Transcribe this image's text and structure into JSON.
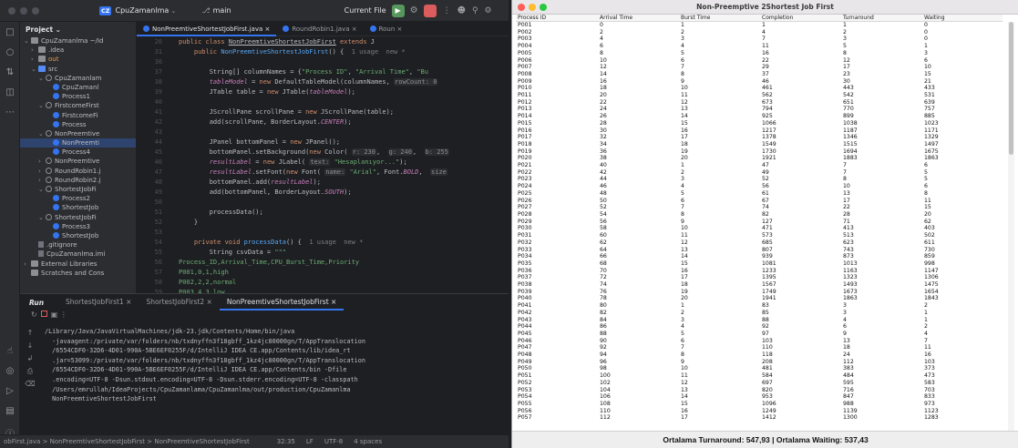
{
  "ide": {
    "project_badge": "CZ",
    "project_name": "CpuZamanlma",
    "branch": "main",
    "current_file": "Current File",
    "project_panel_title": "Project",
    "tree": [
      {
        "label": "CpuZamanlma ~/Id",
        "indent": 0,
        "icon": "folder",
        "arrow": "v"
      },
      {
        "label": ".idea",
        "indent": 1,
        "icon": "folder",
        "arrow": ">"
      },
      {
        "label": "out",
        "indent": 1,
        "icon": "folder",
        "arrow": ">",
        "style": "orange"
      },
      {
        "label": "src",
        "indent": 1,
        "icon": "folder-blue",
        "arrow": "v"
      },
      {
        "label": "CpuZamanlam",
        "indent": 2,
        "icon": "pkg",
        "arrow": "v"
      },
      {
        "label": "CpuZamanl",
        "indent": 3,
        "icon": "class",
        "arrow": ""
      },
      {
        "label": "Process1",
        "indent": 3,
        "icon": "class",
        "arrow": ""
      },
      {
        "label": "FirstcomeFirst",
        "indent": 2,
        "icon": "pkg",
        "arrow": "v"
      },
      {
        "label": "FirstcomeFi",
        "indent": 3,
        "icon": "class",
        "arrow": ""
      },
      {
        "label": "Process",
        "indent": 3,
        "icon": "class",
        "arrow": ""
      },
      {
        "label": "NonPreemtive",
        "indent": 2,
        "icon": "pkg",
        "arrow": "v"
      },
      {
        "label": "NonPreemti",
        "indent": 3,
        "icon": "class",
        "arrow": "",
        "style": "sel"
      },
      {
        "label": "Process4",
        "indent": 3,
        "icon": "class",
        "arrow": ""
      },
      {
        "label": "NonPreemtive",
        "indent": 2,
        "icon": "pkg",
        "arrow": ">"
      },
      {
        "label": "RoundRobin1.j",
        "indent": 2,
        "icon": "pkg",
        "arrow": ">"
      },
      {
        "label": "RoundRobin2.j",
        "indent": 2,
        "icon": "pkg",
        "arrow": ">"
      },
      {
        "label": "ShortestJobFi",
        "indent": 2,
        "icon": "pkg",
        "arrow": "v"
      },
      {
        "label": "Process2",
        "indent": 3,
        "icon": "class",
        "arrow": ""
      },
      {
        "label": "ShortestJob",
        "indent": 3,
        "icon": "class",
        "arrow": ""
      },
      {
        "label": "ShortestJobFi",
        "indent": 2,
        "icon": "pkg",
        "arrow": "v"
      },
      {
        "label": "Process3",
        "indent": 3,
        "icon": "class",
        "arrow": ""
      },
      {
        "label": "ShortestJob",
        "indent": 3,
        "icon": "class",
        "arrow": ""
      },
      {
        "label": ".gitignore",
        "indent": 1,
        "icon": "file",
        "arrow": ""
      },
      {
        "label": "CpuZamanlma.imi",
        "indent": 1,
        "icon": "file",
        "arrow": ""
      },
      {
        "label": "External Libraries",
        "indent": 0,
        "icon": "folder",
        "arrow": ">"
      },
      {
        "label": "Scratches and Cons",
        "indent": 0,
        "icon": "folder",
        "arrow": ""
      }
    ],
    "editor_tabs": [
      {
        "label": "NonPreemtiveShortestJobFirst.java",
        "active": true
      },
      {
        "label": "RoundRobin1.java",
        "active": false
      },
      {
        "label": "Roun",
        "active": false
      }
    ],
    "run_title": "Run",
    "run_tabs": [
      {
        "label": "ShortestJobFirst1",
        "active": false
      },
      {
        "label": "ShortestJobFirst2",
        "active": false
      },
      {
        "label": "NonPreemtiveShortestJobFirst",
        "active": true
      }
    ],
    "console_text": "/Library/Java/JavaVirtualMachines/jdk-23.jdk/Contents/Home/bin/java\n  -javaagent:/private/var/folders/nb/txdnyffn3f18gbff_1kz4jc80000gn/T/AppTranslocation\n  /6554CDF0-32D6-4D01-990A-5BE6EF0255F/d/IntelliJ IDEA CE.app/Contents/lib/idea_rt\n  .jar=53099:/private/var/folders/nb/txdnyffn3f18gbff_1kz4jc80000gn/T/AppTranslocation\n  /6554CDF0-32D6-4D01-990A-5BE6EF0255F/d/IntelliJ IDEA CE.app/Contents/bin -Dfile\n  .encoding=UTF-8 -Dsun.stdout.encoding=UTF-8 -Dsun.stderr.encoding=UTF-8 -classpath\n  /Users/emrullah/IdeaProjects/CpuZamanlama/CpuZamanlma/out/production/CpuZamanlma\n  NonPreemtiveShortestJobFirst",
    "status": {
      "breadcrumb": "obFirst.java > NonPreemtiveShortestJobFirst > NonPreemtiveShortestJobFirst",
      "position": "32:35",
      "line_ending": "LF",
      "encoding": "UTF-8",
      "indent": "4 spaces"
    }
  },
  "app": {
    "title": "Non-Preemptive 2Shortest Job First",
    "columns": [
      "Process ID",
      "Arrival Time",
      "Burst Time",
      "Completion",
      "Turnaround",
      "Waiting"
    ],
    "rows": [
      [
        "P001",
        "0",
        "1",
        "1",
        "1",
        "0"
      ],
      [
        "P002",
        "2",
        "2",
        "4",
        "2",
        "0"
      ],
      [
        "P003",
        "4",
        "3",
        "7",
        "3",
        "0"
      ],
      [
        "P004",
        "6",
        "4",
        "11",
        "5",
        "1"
      ],
      [
        "P005",
        "8",
        "5",
        "16",
        "8",
        "3"
      ],
      [
        "P006",
        "10",
        "6",
        "22",
        "12",
        "6"
      ],
      [
        "P007",
        "12",
        "7",
        "29",
        "17",
        "10"
      ],
      [
        "P008",
        "14",
        "8",
        "37",
        "23",
        "15"
      ],
      [
        "P009",
        "16",
        "9",
        "46",
        "30",
        "21"
      ],
      [
        "P010",
        "18",
        "10",
        "461",
        "443",
        "433"
      ],
      [
        "P011",
        "20",
        "11",
        "562",
        "542",
        "531"
      ],
      [
        "P012",
        "22",
        "12",
        "673",
        "651",
        "639"
      ],
      [
        "P013",
        "24",
        "13",
        "794",
        "770",
        "757"
      ],
      [
        "P014",
        "26",
        "14",
        "925",
        "899",
        "885"
      ],
      [
        "P015",
        "28",
        "15",
        "1066",
        "1038",
        "1023"
      ],
      [
        "P016",
        "30",
        "16",
        "1217",
        "1187",
        "1171"
      ],
      [
        "P017",
        "32",
        "17",
        "1378",
        "1346",
        "1329"
      ],
      [
        "P018",
        "34",
        "18",
        "1549",
        "1515",
        "1497"
      ],
      [
        "P019",
        "36",
        "19",
        "1730",
        "1694",
        "1675"
      ],
      [
        "P020",
        "38",
        "20",
        "1921",
        "1883",
        "1863"
      ],
      [
        "P021",
        "40",
        "1",
        "47",
        "7",
        "6"
      ],
      [
        "P022",
        "42",
        "2",
        "49",
        "7",
        "5"
      ],
      [
        "P023",
        "44",
        "3",
        "52",
        "8",
        "5"
      ],
      [
        "P024",
        "46",
        "4",
        "56",
        "10",
        "6"
      ],
      [
        "P025",
        "48",
        "5",
        "61",
        "13",
        "8"
      ],
      [
        "P026",
        "50",
        "6",
        "67",
        "17",
        "11"
      ],
      [
        "P027",
        "52",
        "7",
        "74",
        "22",
        "15"
      ],
      [
        "P028",
        "54",
        "8",
        "82",
        "28",
        "20"
      ],
      [
        "P029",
        "56",
        "9",
        "127",
        "71",
        "62"
      ],
      [
        "P030",
        "58",
        "10",
        "471",
        "413",
        "403"
      ],
      [
        "P031",
        "60",
        "11",
        "573",
        "513",
        "502"
      ],
      [
        "P032",
        "62",
        "12",
        "685",
        "623",
        "611"
      ],
      [
        "P033",
        "64",
        "13",
        "807",
        "743",
        "730"
      ],
      [
        "P034",
        "66",
        "14",
        "939",
        "873",
        "859"
      ],
      [
        "P035",
        "68",
        "15",
        "1081",
        "1013",
        "998"
      ],
      [
        "P036",
        "70",
        "16",
        "1233",
        "1163",
        "1147"
      ],
      [
        "P037",
        "72",
        "17",
        "1395",
        "1323",
        "1306"
      ],
      [
        "P038",
        "74",
        "18",
        "1567",
        "1493",
        "1475"
      ],
      [
        "P039",
        "76",
        "19",
        "1749",
        "1673",
        "1654"
      ],
      [
        "P040",
        "78",
        "20",
        "1941",
        "1863",
        "1843"
      ],
      [
        "P041",
        "80",
        "1",
        "83",
        "3",
        "2"
      ],
      [
        "P042",
        "82",
        "2",
        "85",
        "3",
        "1"
      ],
      [
        "P043",
        "84",
        "3",
        "88",
        "4",
        "1"
      ],
      [
        "P044",
        "86",
        "4",
        "92",
        "6",
        "2"
      ],
      [
        "P045",
        "88",
        "5",
        "97",
        "9",
        "4"
      ],
      [
        "P046",
        "90",
        "6",
        "103",
        "13",
        "7"
      ],
      [
        "P047",
        "92",
        "7",
        "110",
        "18",
        "11"
      ],
      [
        "P048",
        "94",
        "8",
        "118",
        "24",
        "16"
      ],
      [
        "P049",
        "96",
        "9",
        "208",
        "112",
        "103"
      ],
      [
        "P050",
        "98",
        "10",
        "481",
        "383",
        "373"
      ],
      [
        "P051",
        "100",
        "11",
        "584",
        "484",
        "473"
      ],
      [
        "P052",
        "102",
        "12",
        "697",
        "595",
        "583"
      ],
      [
        "P053",
        "104",
        "13",
        "820",
        "716",
        "703"
      ],
      [
        "P054",
        "106",
        "14",
        "953",
        "847",
        "833"
      ],
      [
        "P055",
        "108",
        "15",
        "1096",
        "988",
        "973"
      ],
      [
        "P056",
        "110",
        "16",
        "1249",
        "1139",
        "1123"
      ],
      [
        "P057",
        "112",
        "17",
        "1412",
        "1300",
        "1283"
      ]
    ],
    "summary": "Ortalama Turnaround: 547,93 | Ortalama Waiting: 537,43"
  }
}
